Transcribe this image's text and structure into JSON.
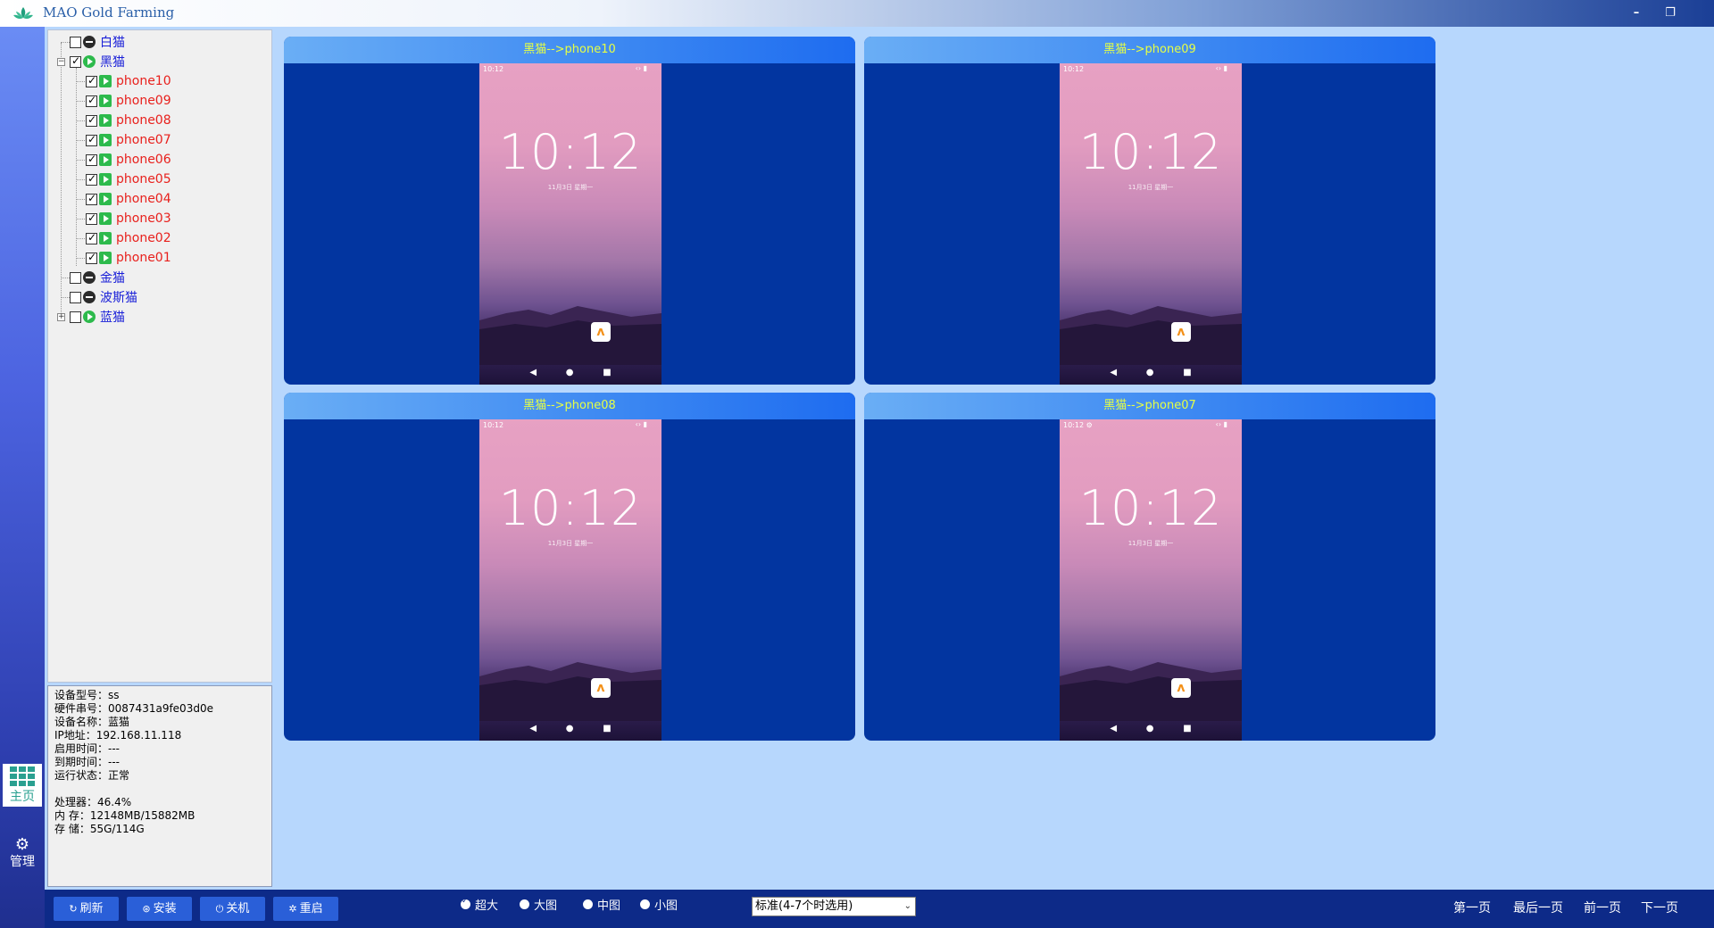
{
  "app": {
    "title": "MAO Gold Farming",
    "logo_icon": "lotus-logo-icon"
  },
  "window_controls": {
    "minimize": "–",
    "restore": "❐",
    "close": "✕"
  },
  "nav": {
    "home": "主页",
    "manage": "管理"
  },
  "tree": {
    "groups": [
      {
        "label": "白猫",
        "checked": false,
        "status": "stop"
      },
      {
        "label": "黑猫",
        "checked": true,
        "status": "run",
        "expanded": true,
        "devices": [
          "phone10",
          "phone09",
          "phone08",
          "phone07",
          "phone06",
          "phone05",
          "phone04",
          "phone03",
          "phone02",
          "phone01"
        ]
      },
      {
        "label": "金猫",
        "checked": false,
        "status": "stop"
      },
      {
        "label": "波斯猫",
        "checked": false,
        "status": "stop"
      },
      {
        "label": "蓝猫",
        "checked": false,
        "status": "run",
        "expandable": true
      }
    ]
  },
  "info": {
    "model_k": "设备型号：",
    "model_v": "ss",
    "serial_k": "硬件串号：",
    "serial_v": "0087431a9fe03d0e",
    "name_k": "设备名称：",
    "name_v": "蓝猫",
    "ip_k": " IP地址：",
    "ip_v": "192.168.11.118",
    "start_k": "启用时间：",
    "start_v": "---",
    "expire_k": "到期时间：",
    "expire_v": "---",
    "state_k": "运行状态：",
    "state_v": "正常",
    "cpu_k": "处理器：",
    "cpu_v": "46.4%",
    "mem_k": "内  存：",
    "mem_v": "12148MB/15882MB",
    "disk_k": "存  储：",
    "disk_v": "55G/114G"
  },
  "cards": [
    {
      "title": "黑猫-->phone10",
      "time": "10:12",
      "status_time": "10:12",
      "date": "11月3日 星期一",
      "status_extra": ""
    },
    {
      "title": "黑猫-->phone09",
      "time": "10:12",
      "status_time": "10:12",
      "date": "11月3日 星期一",
      "status_extra": ""
    },
    {
      "title": "黑猫-->phone08",
      "time": "10:12",
      "status_time": "10:12",
      "date": "11月3日 星期一",
      "status_extra": ""
    },
    {
      "title": "黑猫-->phone07",
      "time": "10:12",
      "status_time": "10:12 ⚙",
      "date": "11月3日 星期一",
      "status_extra": ""
    }
  ],
  "toolbar": {
    "refresh": "刷新",
    "install": "安装",
    "shutdown": "关机",
    "reboot": "重启",
    "sizes": [
      "超大",
      "大图",
      "中图",
      "小图"
    ],
    "selected_size": "超大",
    "mode_select": "标准(4-7个时选用)",
    "first": "第一页",
    "last": "最后一页",
    "prev": "前一页",
    "next": "下一页"
  },
  "colors": {
    "accent": "#2a5fd8",
    "card_bg": "#0235a0",
    "card_title": "#e6ff44",
    "device_label": "#e8201c",
    "group_label": "#1a20d8"
  }
}
